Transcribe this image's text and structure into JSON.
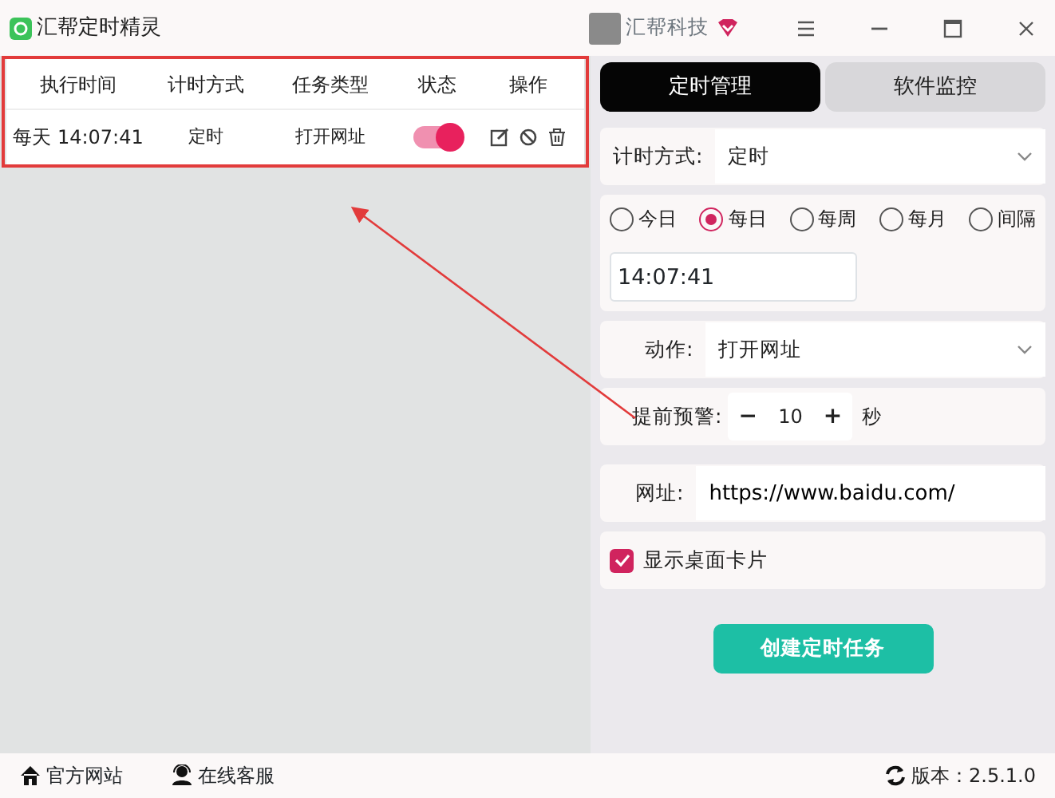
{
  "window": {
    "title": "汇帮定时精灵",
    "user": "汇帮科技"
  },
  "table": {
    "columns": [
      "执行时间",
      "计时方式",
      "任务类型",
      "状态",
      "操作"
    ],
    "rows": [
      {
        "time": "每天 14:07:41",
        "mode": "定时",
        "task": "打开网址",
        "enabled": true
      }
    ]
  },
  "tabs": [
    {
      "label": "定时管理",
      "selected": true
    },
    {
      "label": "软件监控",
      "selected": false
    }
  ],
  "form": {
    "timing_label": "计时方式:",
    "timing_value": "定时",
    "radios": [
      {
        "label": "今日",
        "selected": false
      },
      {
        "label": "每日",
        "selected": true
      },
      {
        "label": "每周",
        "selected": false
      },
      {
        "label": "每月",
        "selected": false
      },
      {
        "label": "间隔",
        "selected": false
      }
    ],
    "time_value": "14:07:41",
    "action_label": "动作:",
    "action_value": "打开网址",
    "warn_label": "提前预警:",
    "decrement": "−",
    "warn_value": "10",
    "increment": "+",
    "warn_unit": "秒",
    "url_label": "网址:",
    "url_value": "https://www.baidu.com/",
    "show_card": {
      "label": "显示桌面卡片",
      "checked": true
    },
    "create_button": "创建定时任务"
  },
  "footer": {
    "links": [
      "官方网站",
      "在线客服"
    ],
    "version": "版本：2.5.1.0"
  }
}
